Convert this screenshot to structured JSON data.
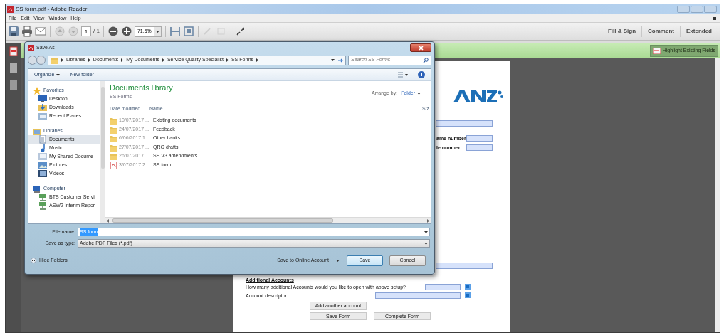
{
  "window": {
    "title": "SS form.pdf - Adobe Reader"
  },
  "menu": [
    "File",
    "Edit",
    "View",
    "Window",
    "Help"
  ],
  "toolbar": {
    "page": "1",
    "page_count": "/ 1",
    "zoom": "71.5%",
    "panes": [
      "Fill & Sign",
      "Comment",
      "Extended"
    ]
  },
  "forms_bar": {
    "button": "Highlight Existing Fields"
  },
  "document": {
    "labels": [
      {
        "text": "ame number"
      },
      {
        "text": "le number"
      }
    ],
    "additional": {
      "heading": "Additional Accounts",
      "question": "How many additional Accounts would you like to open with above setup?",
      "descriptor": "Account descriptor",
      "add_button": "Add another account",
      "save_button": "Save Form",
      "complete_button": "Complete Form"
    }
  },
  "dialog": {
    "title": "Save As",
    "breadcrumb": [
      "Libraries",
      "Documents",
      "My Documents",
      "Service Quality Specialist",
      "SS Forms"
    ],
    "search": {
      "placeholder": "Search SS Forms"
    },
    "commands": [
      "Organize",
      "New folder"
    ],
    "nav": [
      {
        "label": "Favorites",
        "kind": "star",
        "children": [
          {
            "label": "Desktop",
            "kind": "desktop",
            "selected": false
          },
          {
            "label": "Downloads",
            "kind": "downloads",
            "selected": false
          },
          {
            "label": "Recent Places",
            "kind": "recent",
            "selected": false
          }
        ]
      },
      {
        "label": "Libraries",
        "kind": "library",
        "children": [
          {
            "label": "Documents",
            "kind": "document",
            "selected": true
          },
          {
            "label": "Music",
            "kind": "music",
            "selected": false
          },
          {
            "label": "My Shared Docume",
            "kind": "shared",
            "selected": false
          },
          {
            "label": "Pictures",
            "kind": "pictures",
            "selected": false
          },
          {
            "label": "Videos",
            "kind": "videos",
            "selected": false
          }
        ]
      },
      {
        "label": "Computer",
        "kind": "computer",
        "children": [
          {
            "label": "BTS Customer Servi",
            "kind": "network",
            "selected": false
          },
          {
            "label": "ASW2 Interim Repor",
            "kind": "network",
            "selected": false
          }
        ]
      }
    ],
    "library_title": "Documents library",
    "library_subtitle": "SS Forms",
    "arrange_label": "Arrange by:",
    "arrange_value": "Folder",
    "columns": [
      "Date modified",
      "Name",
      "Siz"
    ],
    "files": [
      {
        "date": "10/07/2017 ...",
        "name": "Existing documents",
        "kind": "folder"
      },
      {
        "date": "24/07/2017 ...",
        "name": "Feedback",
        "kind": "folder"
      },
      {
        "date": "6/06/2017 1...",
        "name": "Other banks",
        "kind": "folder"
      },
      {
        "date": "27/07/2017 ...",
        "name": "QRG drafts",
        "kind": "folder"
      },
      {
        "date": "26/07/2017 ...",
        "name": "SS V3 amendments",
        "kind": "folder"
      },
      {
        "date": "3/07/2017 2...",
        "name": "SS form",
        "kind": "pdf"
      }
    ],
    "file_name": {
      "label": "File name:",
      "value": "SS form",
      "text_selected": true
    },
    "save_type": {
      "label": "Save as type:",
      "value": "Adobe PDF Files (*.pdf)"
    },
    "hide_folders": "Hide Folders",
    "online": "Save to Online Account",
    "buttons": [
      "Save",
      "Cancel"
    ]
  }
}
